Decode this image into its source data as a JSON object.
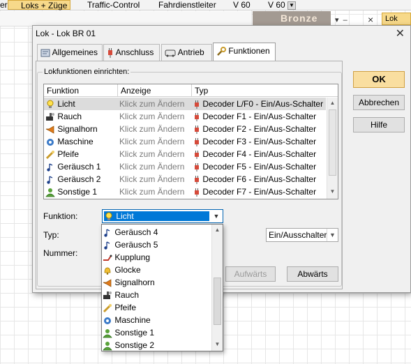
{
  "taskbar": {
    "items": [
      "er",
      "Loks + Züge",
      "Traffic-Control",
      "Fahrdienstleiter",
      "V 60",
      "V 60"
    ],
    "bronze": "Bronze",
    "lok_tab": "Lok"
  },
  "dialog": {
    "title": "Lok - Lok BR 01",
    "tabs": [
      "Allgemeines",
      "Anschluss",
      "Antrieb",
      "Funktionen"
    ],
    "active_tab": "Funktionen",
    "group_label": "Lokfunktionen einrichten:",
    "list": {
      "headers": [
        "Funktion",
        "Anzeige",
        "Typ"
      ],
      "rows": [
        {
          "icon": "bulb-icon",
          "name": "Licht",
          "anzeige": "Klick zum Ändern",
          "typ": "Decoder L/F0 - Ein/Aus-Schalter"
        },
        {
          "icon": "smoke-icon",
          "name": "Rauch",
          "anzeige": "Klick zum Ändern",
          "typ": "Decoder F1 - Ein/Aus-Schalter"
        },
        {
          "icon": "horn-icon",
          "name": "Signalhorn",
          "anzeige": "Klick zum Ändern",
          "typ": "Decoder F2 - Ein/Aus-Schalter"
        },
        {
          "icon": "engine-icon",
          "name": "Maschine",
          "anzeige": "Klick zum Ändern",
          "typ": "Decoder F3 - Ein/Aus-Schalter"
        },
        {
          "icon": "whistle-icon",
          "name": "Pfeife",
          "anzeige": "Klick zum Ändern",
          "typ": "Decoder F4 - Ein/Aus-Schalter"
        },
        {
          "icon": "note-icon",
          "name": "Geräusch 1",
          "anzeige": "Klick zum Ändern",
          "typ": "Decoder F5 - Ein/Aus-Schalter"
        },
        {
          "icon": "note-icon",
          "name": "Geräusch 2",
          "anzeige": "Klick zum Ändern",
          "typ": "Decoder F6 - Ein/Aus-Schalter"
        },
        {
          "icon": "person-icon",
          "name": "Sonstige 1",
          "anzeige": "Klick zum Ändern",
          "typ": "Decoder F7 - Ein/Aus-Schalter"
        }
      ]
    },
    "funktion_label": "Funktion:",
    "funktion_value": "Licht",
    "typ_label": "Typ:",
    "typ_value": "Ein/Ausschalter",
    "nummer_label": "Nummer:",
    "buttons": {
      "ok": "OK",
      "abbrechen": "Abbrechen",
      "hilfe": "Hilfe",
      "aufwaerts": "Aufwärts",
      "abwaerts": "Abwärts"
    },
    "dropdown_items": [
      {
        "icon": "note-icon",
        "label": "Geräusch 4"
      },
      {
        "icon": "note-icon",
        "label": "Geräusch 5"
      },
      {
        "icon": "coupling-icon",
        "label": "Kupplung"
      },
      {
        "icon": "bell-icon",
        "label": "Glocke"
      },
      {
        "icon": "horn-icon",
        "label": "Signalhorn"
      },
      {
        "icon": "smoke-icon",
        "label": "Rauch"
      },
      {
        "icon": "whistle-icon",
        "label": "Pfeife"
      },
      {
        "icon": "engine-icon",
        "label": "Maschine"
      },
      {
        "icon": "person-icon",
        "label": "Sonstige 1"
      },
      {
        "icon": "person-icon",
        "label": "Sonstige 2"
      }
    ]
  }
}
